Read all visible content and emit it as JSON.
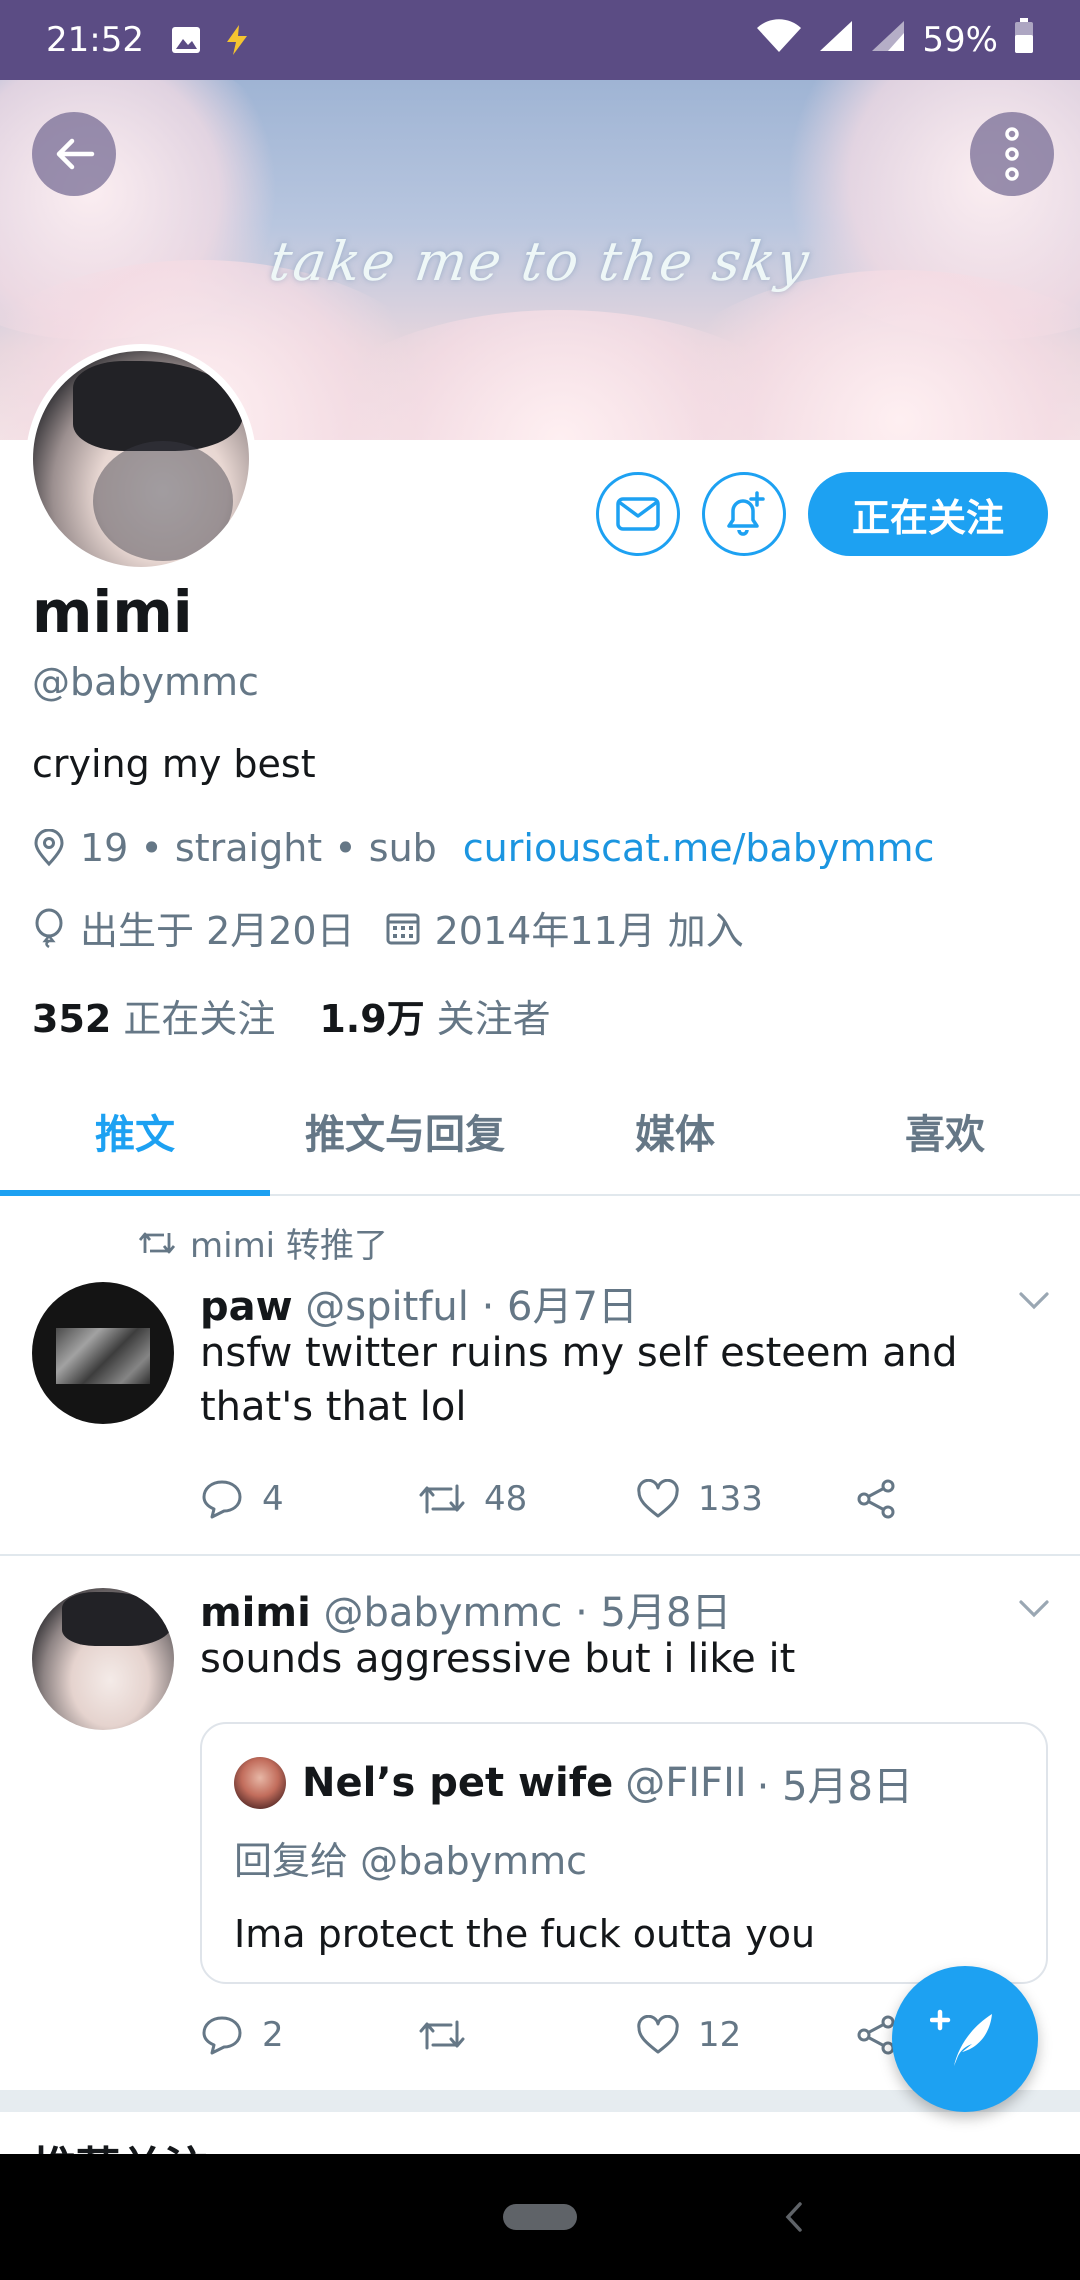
{
  "status_bar": {
    "time": "21:52",
    "battery": "59%"
  },
  "banner": {
    "text": "take me to the sky"
  },
  "profile": {
    "name": "mimi",
    "handle": "@babymmc",
    "bio": "crying my best",
    "location": "19 • straight • sub",
    "link": "curiouscat.me/babymmc",
    "birthday": "出生于 2月20日",
    "joined": "2014年11月 加入",
    "following_count": "352",
    "following_label": "正在关注",
    "followers_count": "1.9万",
    "followers_label": "关注者",
    "follow_button": "正在关注"
  },
  "tabs": [
    "推文",
    "推文与回复",
    "媒体",
    "喜欢"
  ],
  "tweets": [
    {
      "retweeted_by": "mimi 转推了",
      "name": "paw",
      "handle": "@spitful",
      "date": "· 6月7日",
      "text": "nsfw twitter ruins my self esteem and that's that lol",
      "replies": "4",
      "retweets": "48",
      "likes": "133"
    },
    {
      "name": "mimi",
      "handle": "@babymmc",
      "date": "· 5月8日",
      "text": "sounds aggressive but i like it",
      "quote": {
        "name": "Nel’s pet wife",
        "handle": "@FIFII",
        "date": "· 5月8日",
        "reply_to": "回复给 @babymmc",
        "text": "Ima protect the fuck outta you"
      },
      "replies": "2",
      "retweets": "",
      "likes": "12"
    }
  ],
  "suggested_partial": "推荐关注"
}
